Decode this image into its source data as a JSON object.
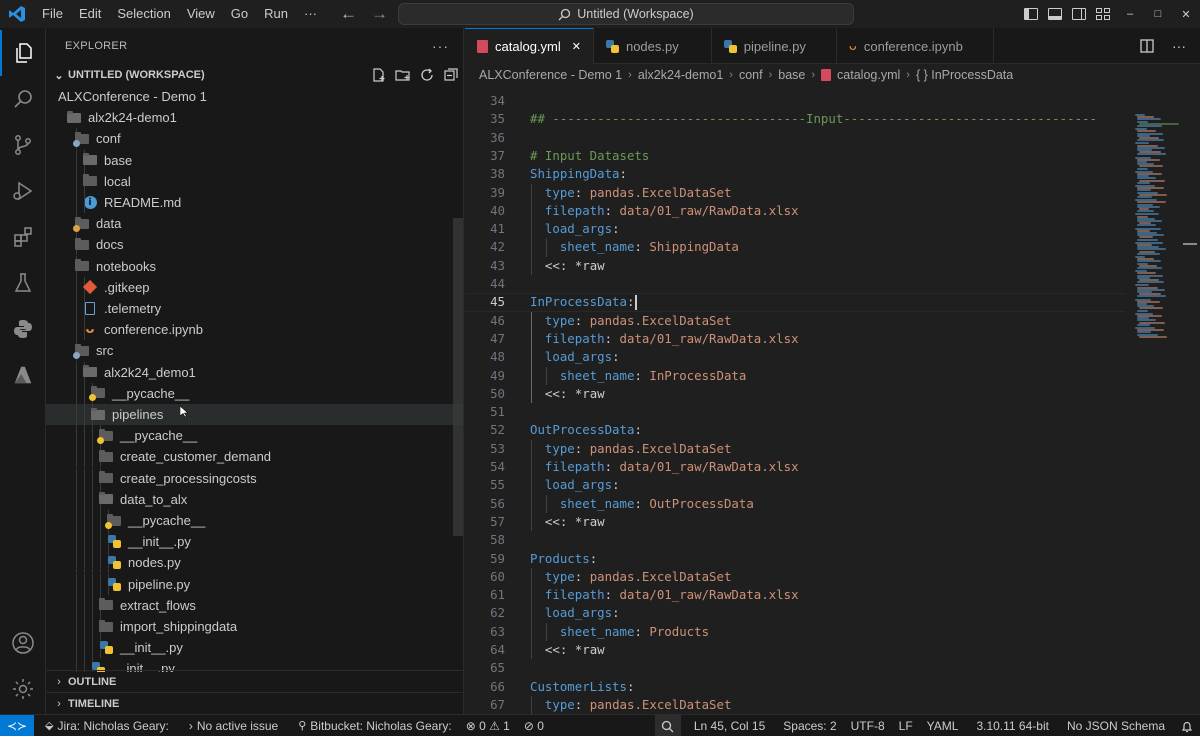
{
  "titlebar": {
    "menu": [
      "File",
      "Edit",
      "Selection",
      "View",
      "Go",
      "Run",
      "···"
    ],
    "command_center": "Untitled (Workspace)",
    "window_controls": [
      "–",
      "□",
      "✕"
    ]
  },
  "activitybar": {
    "items": [
      "explorer-icon",
      "search-icon",
      "source-control-icon",
      "run-debug-icon",
      "extensions-icon",
      "testing-icon",
      "python-icon",
      "azure-icon"
    ],
    "bottom": [
      "accounts-icon",
      "manage-gear-icon"
    ]
  },
  "sidebar": {
    "title": "EXPLORER",
    "more": "···",
    "workspace": "UNTITLED (WORKSPACE)",
    "tree": [
      {
        "label": "ALXConference - Demo 1",
        "depth": 0,
        "icon": "none"
      },
      {
        "label": "alx2k24-demo1",
        "depth": 1,
        "icon": "folder-open"
      },
      {
        "label": "conf",
        "depth": 2,
        "icon": "folder-config"
      },
      {
        "label": "base",
        "depth": 3,
        "icon": "folder-open"
      },
      {
        "label": "local",
        "depth": 3,
        "icon": "folder"
      },
      {
        "label": "README.md",
        "depth": 3,
        "icon": "info"
      },
      {
        "label": "data",
        "depth": 2,
        "icon": "folder-data"
      },
      {
        "label": "docs",
        "depth": 2,
        "icon": "folder"
      },
      {
        "label": "notebooks",
        "depth": 2,
        "icon": "folder"
      },
      {
        "label": ".gitkeep",
        "depth": 3,
        "icon": "git"
      },
      {
        "label": ".telemetry",
        "depth": 3,
        "icon": "file"
      },
      {
        "label": "conference.ipynb",
        "depth": 3,
        "icon": "notebook"
      },
      {
        "label": "src",
        "depth": 2,
        "icon": "folder-config"
      },
      {
        "label": "alx2k24_demo1",
        "depth": 3,
        "icon": "folder-open"
      },
      {
        "label": "__pycache__",
        "depth": 4,
        "icon": "folder-py"
      },
      {
        "label": "pipelines",
        "depth": 4,
        "icon": "folder-open"
      },
      {
        "label": "__pycache__",
        "depth": 5,
        "icon": "folder-py"
      },
      {
        "label": "create_customer_demand",
        "depth": 5,
        "icon": "folder"
      },
      {
        "label": "create_processingcosts",
        "depth": 5,
        "icon": "folder"
      },
      {
        "label": "data_to_alx",
        "depth": 5,
        "icon": "folder-open"
      },
      {
        "label": "__pycache__",
        "depth": 6,
        "icon": "folder-py"
      },
      {
        "label": "__init__.py",
        "depth": 6,
        "icon": "python"
      },
      {
        "label": "nodes.py",
        "depth": 6,
        "icon": "python"
      },
      {
        "label": "pipeline.py",
        "depth": 6,
        "icon": "python"
      },
      {
        "label": "extract_flows",
        "depth": 5,
        "icon": "folder"
      },
      {
        "label": "import_shippingdata",
        "depth": 5,
        "icon": "folder"
      },
      {
        "label": "__init__.py",
        "depth": 5,
        "icon": "python"
      },
      {
        "label": "__init__.py",
        "depth": 4,
        "icon": "python"
      }
    ],
    "outline": "OUTLINE",
    "timeline": "TIMELINE"
  },
  "editor": {
    "tabs": [
      {
        "label": "catalog.yml",
        "icon": "yaml",
        "active": true,
        "close": "✕"
      },
      {
        "label": "nodes.py",
        "icon": "python",
        "active": false
      },
      {
        "label": "pipeline.py",
        "icon": "python",
        "active": false
      },
      {
        "label": "conference.ipynb",
        "icon": "notebook",
        "active": false
      }
    ],
    "breadcrumb": [
      "ALXConference - Demo 1",
      "alx2k24-demo1",
      "conf",
      "base",
      "catalog.yml",
      "{ } InProcessData"
    ],
    "current_line": 45,
    "lines": [
      {
        "n": 34,
        "t": ""
      },
      {
        "n": 35,
        "t": "## ----------------------------------Input----------------------------------"
      },
      {
        "n": 36,
        "t": ""
      },
      {
        "n": 37,
        "t": "# Input Datasets"
      },
      {
        "n": 38,
        "t": "ShippingData:"
      },
      {
        "n": 39,
        "t": "  type: pandas.ExcelDataSet"
      },
      {
        "n": 40,
        "t": "  filepath: data/01_raw/RawData.xlsx"
      },
      {
        "n": 41,
        "t": "  load_args:"
      },
      {
        "n": 42,
        "t": "    sheet_name: ShippingData"
      },
      {
        "n": 43,
        "t": "  <<: *raw"
      },
      {
        "n": 44,
        "t": ""
      },
      {
        "n": 45,
        "t": "InProcessData:"
      },
      {
        "n": 46,
        "t": "  type: pandas.ExcelDataSet"
      },
      {
        "n": 47,
        "t": "  filepath: data/01_raw/RawData.xlsx"
      },
      {
        "n": 48,
        "t": "  load_args:"
      },
      {
        "n": 49,
        "t": "    sheet_name: InProcessData"
      },
      {
        "n": 50,
        "t": "  <<: *raw"
      },
      {
        "n": 51,
        "t": ""
      },
      {
        "n": 52,
        "t": "OutProcessData:"
      },
      {
        "n": 53,
        "t": "  type: pandas.ExcelDataSet"
      },
      {
        "n": 54,
        "t": "  filepath: data/01_raw/RawData.xlsx"
      },
      {
        "n": 55,
        "t": "  load_args:"
      },
      {
        "n": 56,
        "t": "    sheet_name: OutProcessData"
      },
      {
        "n": 57,
        "t": "  <<: *raw"
      },
      {
        "n": 58,
        "t": ""
      },
      {
        "n": 59,
        "t": "Products:"
      },
      {
        "n": 60,
        "t": "  type: pandas.ExcelDataSet"
      },
      {
        "n": 61,
        "t": "  filepath: data/01_raw/RawData.xlsx"
      },
      {
        "n": 62,
        "t": "  load_args:"
      },
      {
        "n": 63,
        "t": "    sheet_name: Products"
      },
      {
        "n": 64,
        "t": "  <<: *raw"
      },
      {
        "n": 65,
        "t": ""
      },
      {
        "n": 66,
        "t": "CustomerLists:"
      },
      {
        "n": 67,
        "t": "  type: pandas.ExcelDataSet"
      }
    ]
  },
  "statusbar": {
    "remote": "≺≻",
    "left": [
      {
        "icon": "jira-icon",
        "text": "Jira: Nicholas Geary:"
      },
      {
        "icon": "chevron-icon",
        "text": "No active issue"
      },
      {
        "icon": "bitbucket-icon",
        "text": "Bitbucket: Nicholas Geary:"
      },
      {
        "icon": "problems-icon",
        "text": "⊗ 0 ⚠ 1"
      },
      {
        "icon": "ports-icon",
        "text": "⊘ 0"
      }
    ],
    "right": [
      "Ln 45, Col 15",
      "Spaces: 2",
      "UTF-8",
      "LF",
      "YAML",
      "3.10.11 64-bit",
      "No JSON Schema"
    ],
    "zoom_icon": "🔍"
  },
  "colors": {
    "accent": "#0078d4",
    "yaml_key": "#569cd6",
    "yaml_value": "#ce9178",
    "comment": "#6a9955"
  }
}
